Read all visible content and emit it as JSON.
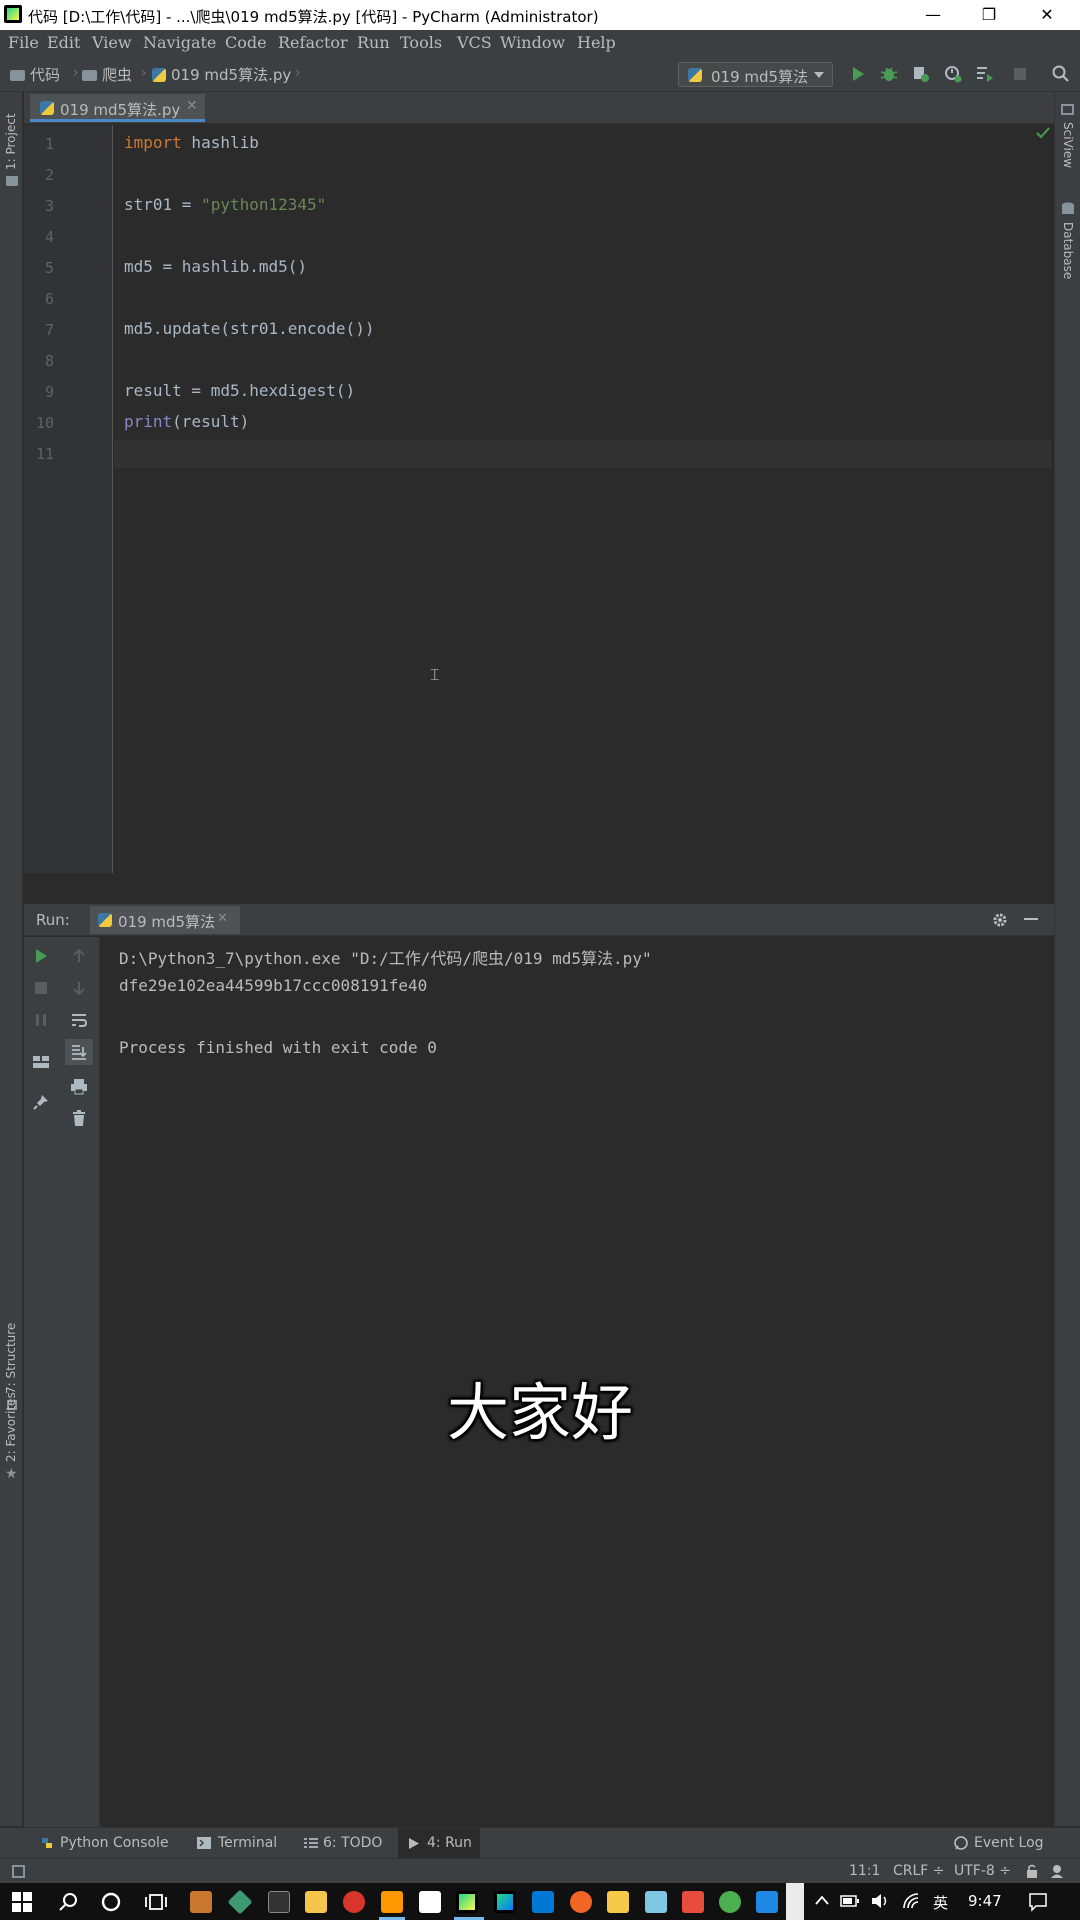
{
  "window": {
    "title": "代码 [D:\\工作\\代码] - ...\\爬虫\\019 md5算法.py [代码] - PyCharm (Administrator)",
    "minimize": "—",
    "maximize": "❐",
    "close": "✕"
  },
  "menu": [
    "File",
    "Edit",
    "View",
    "Navigate",
    "Code",
    "Refactor",
    "Run",
    "Tools",
    "VCS",
    "Window",
    "Help"
  ],
  "breadcrumb": {
    "root": "代码",
    "folder": "爬虫",
    "file": "019 md5算法.py"
  },
  "run_config": {
    "name": "019 md5算法"
  },
  "left_tools": {
    "project": "1: Project",
    "structure": "7: Structure",
    "favorites": "2: Favorites"
  },
  "right_tools": {
    "sciview": "SciView",
    "database": "Database"
  },
  "editor": {
    "tab": "019 md5算法.py",
    "line_numbers": [
      "1",
      "2",
      "3",
      "4",
      "5",
      "6",
      "7",
      "8",
      "9",
      "10",
      "11"
    ],
    "lines": {
      "l1_kw": "import",
      "l1_rest": " hashlib",
      "l3_a": "str01 = ",
      "l3_str": "\"python12345\"",
      "l5": "md5 = hashlib.md5()",
      "l7": "md5.update(str01.encode())",
      "l9": "result = md5.hexdigest()",
      "l10_fn": "print",
      "l10_rest": "(result)"
    }
  },
  "run_panel": {
    "label": "Run:",
    "tab": "019 md5算法",
    "console": [
      "D:\\Python3_7\\python.exe \"D:/工作/代码/爬虫/019 md5算法.py\"",
      "dfe29e102ea44599b17ccc008191fe40",
      "",
      "Process finished with exit code 0"
    ]
  },
  "subtitle": "大家好",
  "bottom_tabs": {
    "python_console": "Python Console",
    "terminal": "Terminal",
    "todo": "6: TODO",
    "run": "4: Run",
    "event_log": "Event Log"
  },
  "status": {
    "position": "11:1",
    "line_sep": "CRLF ÷",
    "encoding": "UTF-8 ÷"
  },
  "taskbar": {
    "ime": "英",
    "time": "9:47"
  },
  "colors": {
    "accent": "#4a88c7",
    "run_green": "#499c54",
    "keyword": "#cc7832",
    "string": "#6a8759"
  }
}
